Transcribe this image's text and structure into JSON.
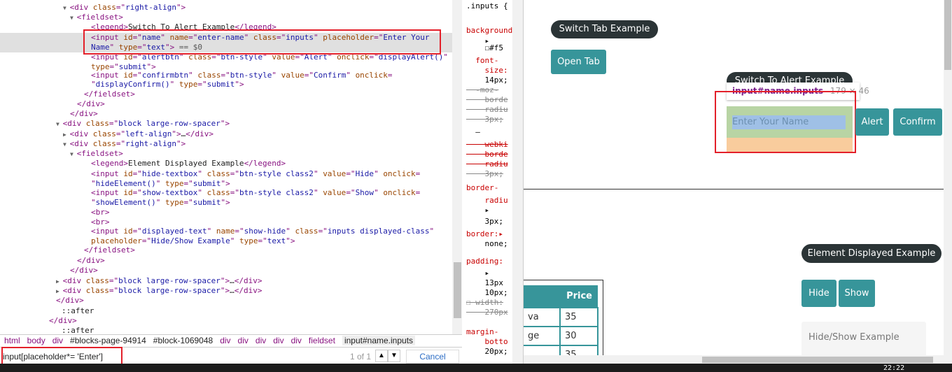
{
  "elements_panel": {
    "more_icon": "…",
    "lines": [
      [
        [
          "t",
          "<div "
        ],
        [
          "a",
          "class"
        ],
        [
          "t",
          "=\""
        ],
        [
          "v",
          "right-align"
        ],
        [
          "t",
          "\">"
        ]
      ],
      [
        [
          "t",
          "<fieldset>"
        ]
      ],
      [
        [
          "t",
          "<legend>"
        ],
        [
          "x",
          "Switch To Alert Example"
        ],
        [
          "t",
          "</legend>"
        ]
      ],
      [
        [
          "t",
          "<input "
        ],
        [
          "a",
          "id"
        ],
        [
          "t",
          "=\""
        ],
        [
          "v",
          "name"
        ],
        [
          "t",
          "\" "
        ],
        [
          "a",
          "name"
        ],
        [
          "t",
          "=\""
        ],
        [
          "v",
          "enter-name"
        ],
        [
          "t",
          "\" "
        ],
        [
          "a",
          "class"
        ],
        [
          "t",
          "=\""
        ],
        [
          "v",
          "inputs"
        ],
        [
          "t",
          "\" "
        ],
        [
          "a",
          "placeholder"
        ],
        [
          "t",
          "=\""
        ],
        [
          "v",
          "Enter Your"
        ]
      ],
      [
        [
          "v",
          "Name"
        ],
        [
          "t",
          "\" "
        ],
        [
          "a",
          "type"
        ],
        [
          "t",
          "=\""
        ],
        [
          "v",
          "text"
        ],
        [
          "t",
          "\">"
        ],
        [
          "c",
          " == $0"
        ]
      ],
      [
        [
          "t",
          "<input "
        ],
        [
          "a",
          "id"
        ],
        [
          "t",
          "=\""
        ],
        [
          "v",
          "alertbtn"
        ],
        [
          "t",
          "\" "
        ],
        [
          "a",
          "class"
        ],
        [
          "t",
          "=\""
        ],
        [
          "v",
          "btn-style"
        ],
        [
          "t",
          "\" "
        ],
        [
          "a",
          "value"
        ],
        [
          "t",
          "=\""
        ],
        [
          "v",
          "Alert"
        ],
        [
          "t",
          "\" "
        ],
        [
          "a",
          "onclick"
        ],
        [
          "t",
          "=\""
        ],
        [
          "v",
          "displayAlert()"
        ],
        [
          "t",
          "\""
        ]
      ],
      [
        [
          "a",
          "type"
        ],
        [
          "t",
          "=\""
        ],
        [
          "v",
          "submit"
        ],
        [
          "t",
          "\">"
        ]
      ],
      [
        [
          "t",
          "<input "
        ],
        [
          "a",
          "id"
        ],
        [
          "t",
          "=\""
        ],
        [
          "v",
          "confirmbtn"
        ],
        [
          "t",
          "\" "
        ],
        [
          "a",
          "class"
        ],
        [
          "t",
          "=\""
        ],
        [
          "v",
          "btn-style"
        ],
        [
          "t",
          "\" "
        ],
        [
          "a",
          "value"
        ],
        [
          "t",
          "=\""
        ],
        [
          "v",
          "Confirm"
        ],
        [
          "t",
          "\" "
        ],
        [
          "a",
          "onclick"
        ],
        [
          "t",
          "="
        ]
      ],
      [
        [
          "t",
          "\""
        ],
        [
          "v",
          "displayConfirm()"
        ],
        [
          "t",
          "\" "
        ],
        [
          "a",
          "type"
        ],
        [
          "t",
          "=\""
        ],
        [
          "v",
          "submit"
        ],
        [
          "t",
          "\">"
        ]
      ],
      [
        [
          "t",
          "</fieldset>"
        ]
      ],
      [
        [
          "t",
          "</div>"
        ]
      ],
      [
        [
          "t",
          "</div>"
        ]
      ],
      [
        [
          "t",
          "<div "
        ],
        [
          "a",
          "class"
        ],
        [
          "t",
          "=\""
        ],
        [
          "v",
          "block large-row-spacer"
        ],
        [
          "t",
          "\">"
        ]
      ],
      [
        [
          "t",
          "<div "
        ],
        [
          "a",
          "class"
        ],
        [
          "t",
          "=\""
        ],
        [
          "v",
          "left-align"
        ],
        [
          "t",
          "\">"
        ],
        [
          "x",
          "…"
        ],
        [
          "t",
          "</div>"
        ]
      ],
      [
        [
          "t",
          "<div "
        ],
        [
          "a",
          "class"
        ],
        [
          "t",
          "=\""
        ],
        [
          "v",
          "right-align"
        ],
        [
          "t",
          "\">"
        ]
      ],
      [
        [
          "t",
          "<fieldset>"
        ]
      ],
      [
        [
          "t",
          "<legend>"
        ],
        [
          "x",
          "Element Displayed Example"
        ],
        [
          "t",
          "</legend>"
        ]
      ],
      [
        [
          "t",
          "<input "
        ],
        [
          "a",
          "id"
        ],
        [
          "t",
          "=\""
        ],
        [
          "v",
          "hide-textbox"
        ],
        [
          "t",
          "\" "
        ],
        [
          "a",
          "class"
        ],
        [
          "t",
          "=\""
        ],
        [
          "v",
          "btn-style class2"
        ],
        [
          "t",
          "\" "
        ],
        [
          "a",
          "value"
        ],
        [
          "t",
          "=\""
        ],
        [
          "v",
          "Hide"
        ],
        [
          "t",
          "\" "
        ],
        [
          "a",
          "onclick"
        ],
        [
          "t",
          "="
        ]
      ],
      [
        [
          "t",
          "\""
        ],
        [
          "v",
          "hideElement()"
        ],
        [
          "t",
          "\" "
        ],
        [
          "a",
          "type"
        ],
        [
          "t",
          "=\""
        ],
        [
          "v",
          "submit"
        ],
        [
          "t",
          "\">"
        ]
      ],
      [
        [
          "t",
          "<input "
        ],
        [
          "a",
          "id"
        ],
        [
          "t",
          "=\""
        ],
        [
          "v",
          "show-textbox"
        ],
        [
          "t",
          "\" "
        ],
        [
          "a",
          "class"
        ],
        [
          "t",
          "=\""
        ],
        [
          "v",
          "btn-style class2"
        ],
        [
          "t",
          "\" "
        ],
        [
          "a",
          "value"
        ],
        [
          "t",
          "=\""
        ],
        [
          "v",
          "Show"
        ],
        [
          "t",
          "\" "
        ],
        [
          "a",
          "onclick"
        ],
        [
          "t",
          "="
        ]
      ],
      [
        [
          "t",
          "\""
        ],
        [
          "v",
          "showElement()"
        ],
        [
          "t",
          "\" "
        ],
        [
          "a",
          "type"
        ],
        [
          "t",
          "=\""
        ],
        [
          "v",
          "submit"
        ],
        [
          "t",
          "\">"
        ]
      ],
      [
        [
          "t",
          "<br>"
        ]
      ],
      [
        [
          "t",
          "<br>"
        ]
      ],
      [
        [
          "t",
          "<input "
        ],
        [
          "a",
          "id"
        ],
        [
          "t",
          "=\""
        ],
        [
          "v",
          "displayed-text"
        ],
        [
          "t",
          "\" "
        ],
        [
          "a",
          "name"
        ],
        [
          "t",
          "=\""
        ],
        [
          "v",
          "show-hide"
        ],
        [
          "t",
          "\" "
        ],
        [
          "a",
          "class"
        ],
        [
          "t",
          "=\""
        ],
        [
          "v",
          "inputs displayed-class"
        ],
        [
          "t",
          "\""
        ]
      ],
      [
        [
          "a",
          "placeholder"
        ],
        [
          "t",
          "=\""
        ],
        [
          "v",
          "Hide/Show Example"
        ],
        [
          "t",
          "\" "
        ],
        [
          "a",
          "type"
        ],
        [
          "t",
          "=\""
        ],
        [
          "v",
          "text"
        ],
        [
          "t",
          "\">"
        ]
      ],
      [
        [
          "t",
          "</fieldset>"
        ]
      ],
      [
        [
          "t",
          "</div>"
        ]
      ],
      [
        [
          "t",
          "</div>"
        ]
      ],
      [
        [
          "t",
          "<div "
        ],
        [
          "a",
          "class"
        ],
        [
          "t",
          "=\""
        ],
        [
          "v",
          "block large-row-spacer"
        ],
        [
          "t",
          "\">"
        ],
        [
          "x",
          "…"
        ],
        [
          "t",
          "</div>"
        ]
      ],
      [
        [
          "t",
          "<div "
        ],
        [
          "a",
          "class"
        ],
        [
          "t",
          "=\""
        ],
        [
          "v",
          "block large-row-spacer"
        ],
        [
          "t",
          "\">"
        ],
        [
          "x",
          "…"
        ],
        [
          "t",
          "</div>"
        ]
      ],
      [
        [
          "t",
          "</div>"
        ]
      ],
      [
        [
          "x",
          "::after"
        ]
      ],
      [
        [
          "t",
          "</div>"
        ]
      ],
      [
        [
          "x",
          "::after"
        ]
      ]
    ]
  },
  "breadcrumbs": [
    "html",
    "body",
    "div",
    "#blocks-page-94914",
    "#block-1069048",
    "div",
    "div",
    "div",
    "div",
    "div",
    "fieldset",
    "input#name.inputs"
  ],
  "find_bar": {
    "value": "input[placeholder*= 'Enter']",
    "match_count": "1 of 1",
    "prev_icon": "▲",
    "next_icon": "▼",
    "cancel_label": "Cancel"
  },
  "styles_panel": {
    "lines": [
      {
        "text": ".inputs {",
        "k": ""
      },
      {
        "text": "background",
        "k": "p"
      },
      {
        "text": "    ▸",
        "k": ""
      },
      {
        "text": "    ☐#f5",
        "k": ""
      },
      {
        "text": "  font-",
        "k": "p"
      },
      {
        "text": "    size:",
        "k": "p"
      },
      {
        "text": "    14px;",
        "k": ""
      },
      {
        "text": "  -moz-",
        "k": "s"
      },
      {
        "text": "    borde",
        "k": "s"
      },
      {
        "text": "    radiu",
        "k": "s"
      },
      {
        "text": "    3px;",
        "k": "s"
      },
      {
        "text": "  –",
        "k": ""
      },
      {
        "text": "    webki",
        "k": "sp"
      },
      {
        "text": "    borde",
        "k": "sp"
      },
      {
        "text": "    radiu",
        "k": "sp"
      },
      {
        "text": "    3px;",
        "k": "s"
      },
      {
        "text": "border-",
        "k": "p"
      },
      {
        "text": "    radiu",
        "k": "p"
      },
      {
        "text": "    ▸",
        "k": ""
      },
      {
        "text": "    3px;",
        "k": ""
      },
      {
        "text": "border:▸",
        "k": "p"
      },
      {
        "text": "    none;",
        "k": ""
      },
      {
        "text": "padding:",
        "k": "p"
      },
      {
        "text": "    ▸",
        "k": ""
      },
      {
        "text": "    13px",
        "k": ""
      },
      {
        "text": "    10px;",
        "k": ""
      },
      {
        "text": "☐ width:",
        "k": "s"
      },
      {
        "text": "    270px",
        "k": "s"
      },
      {
        "text": "margin-",
        "k": "p"
      },
      {
        "text": "    botto",
        "k": "p"
      },
      {
        "text": "    20px;",
        "k": ""
      }
    ]
  },
  "page": {
    "switch_tab_legend": "Switch Tab Example",
    "open_tab_button": "Open Tab",
    "switch_alert_legend": "Switch To Alert Example",
    "inspect_tooltip": {
      "selector": "input#name.inputs",
      "size": "179 × 46"
    },
    "name_input_placeholder": "Enter Your Name",
    "alert_button": "Alert",
    "confirm_button": "Confirm",
    "table": {
      "header": [
        "",
        "Price"
      ],
      "rows": [
        [
          "va",
          "35"
        ],
        [
          "ge",
          "30"
        ],
        [
          "",
          "35"
        ]
      ]
    },
    "element_displayed_legend": "Element Displayed Example",
    "hide_button": "Hide",
    "show_button": "Show",
    "displayed_text_placeholder": "Hide/Show Example"
  },
  "taskbar": {
    "clock": "22:22"
  },
  "colors": {
    "teal": "#37959a",
    "dark_pill": "#2b3436",
    "highlight_red": "#e3202a",
    "selection_yellow": "#f7f722"
  }
}
